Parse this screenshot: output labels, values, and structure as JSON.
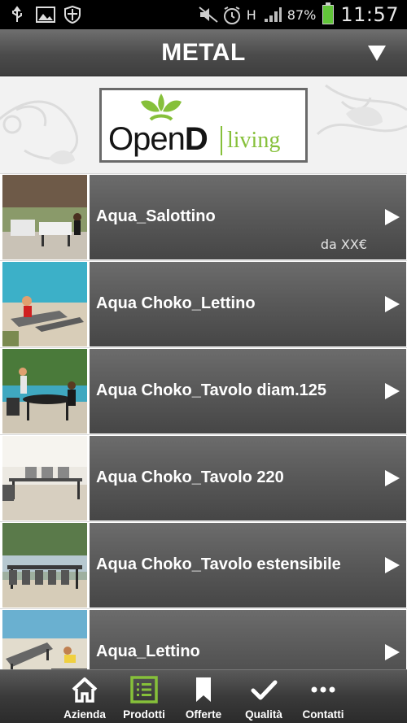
{
  "status_bar": {
    "battery_percent": "87%",
    "network": "H",
    "time": "11:57"
  },
  "header": {
    "title": "METAL"
  },
  "logo": {
    "brand_open": "Open",
    "brand_d": "D",
    "brand_living": "living"
  },
  "colors": {
    "brand_green": "#86c03a",
    "bar_dark": "#3e3e3e"
  },
  "products": [
    {
      "label": "Aqua_Salottino",
      "price": "da XX€"
    },
    {
      "label": "Aqua Choko_Lettino",
      "price": ""
    },
    {
      "label": "Aqua Choko_Tavolo diam.125",
      "price": ""
    },
    {
      "label": "Aqua Choko_Tavolo 220",
      "price": ""
    },
    {
      "label": "Aqua Choko_Tavolo estensibile",
      "price": ""
    },
    {
      "label": "Aqua_Lettino",
      "price": ""
    }
  ],
  "tabs": [
    {
      "label": "Azienda",
      "icon": "home-icon"
    },
    {
      "label": "Prodotti",
      "icon": "list-icon",
      "active": true
    },
    {
      "label": "Offerte",
      "icon": "bookmark-icon"
    },
    {
      "label": "Qualità",
      "icon": "check-icon"
    },
    {
      "label": "Contatti",
      "icon": "more-icon"
    }
  ]
}
